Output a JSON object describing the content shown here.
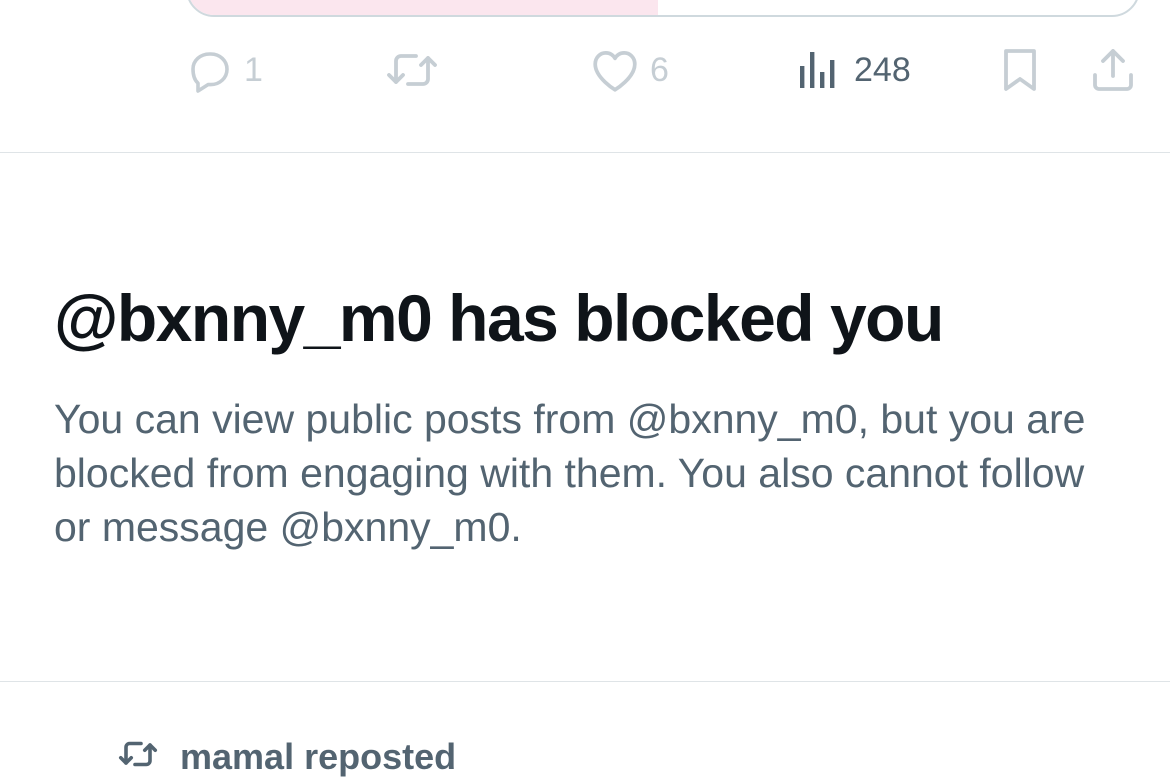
{
  "tweet_actions": {
    "reply_count": "1",
    "like_count": "6",
    "views_count": "248",
    "icons": [
      "reply-icon",
      "repost-icon",
      "like-icon",
      "views-icon",
      "bookmark-icon",
      "share-icon"
    ]
  },
  "blocked_notice": {
    "title": "@bxnny_m0 has blocked you",
    "body": "You can view public posts from @bxnny_m0, but you are blocked from engaging with them. You also cannot follow or message @bxnny_m0."
  },
  "next_item": {
    "repost_label": "mamal reposted"
  },
  "colors": {
    "text_primary": "#0f1419",
    "text_secondary": "#536471",
    "icon_muted": "#c6ced4",
    "divider": "#dfe4e7",
    "media_pink": "#fbe6ee"
  }
}
